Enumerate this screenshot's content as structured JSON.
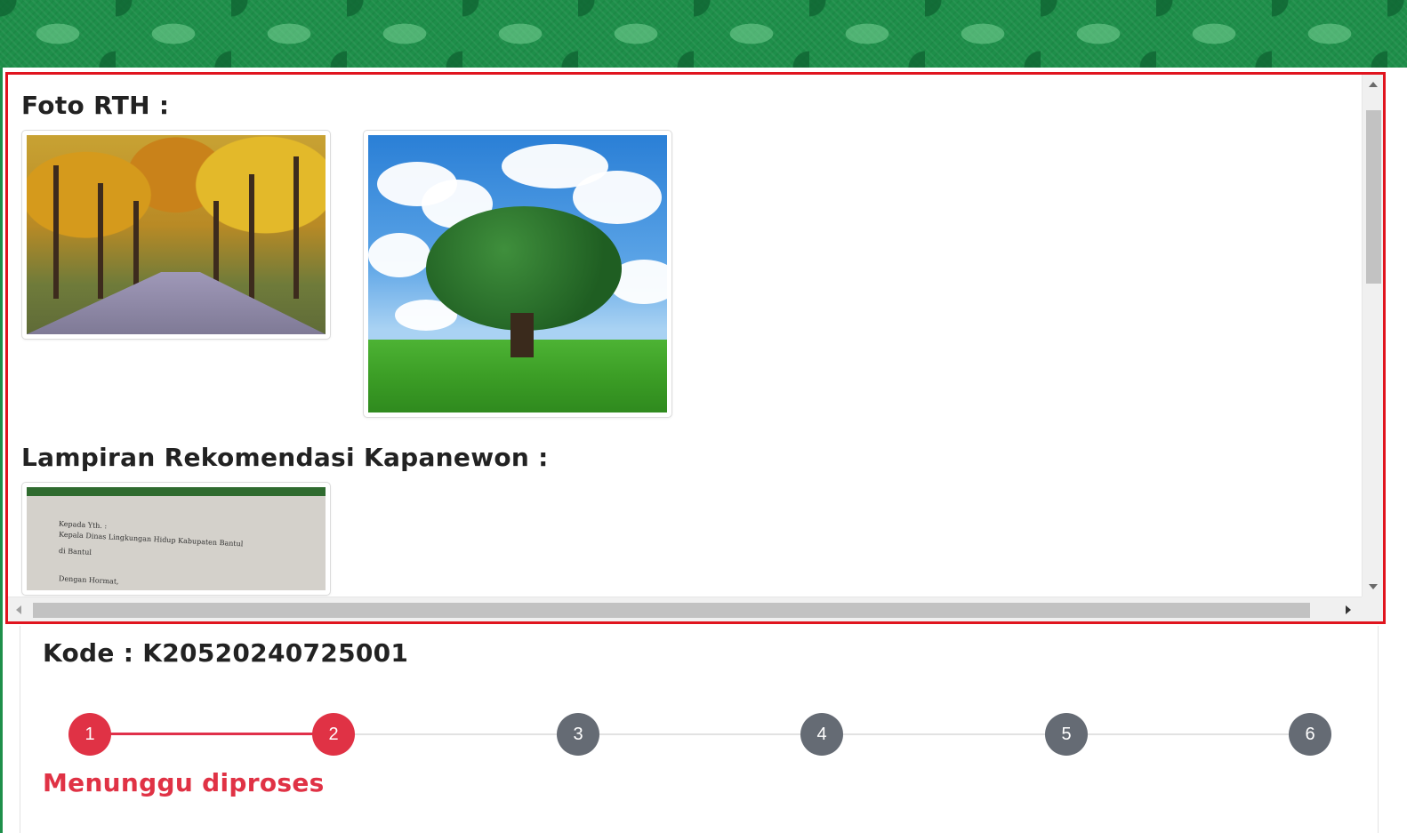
{
  "panel": {
    "foto_title": "Foto RTH :",
    "lampiran_title": "Lampiran Rekomendasi Kapanewon :",
    "document_lines": [
      "Kepada Yth. :",
      "Kepala Dinas Lingkungan Hidup Kabupaten Bantul",
      "di Bantul",
      "Dengan Hormat,"
    ]
  },
  "card": {
    "kode_text": "Kode : K20520240725001",
    "steps": [
      "1",
      "2",
      "3",
      "4",
      "5",
      "6"
    ],
    "active_step": 2,
    "status_text": "Menunggu diproses"
  },
  "colors": {
    "banner_green": "#1e8f4a",
    "panel_border_red": "#e0141e",
    "step_done": "#e03245",
    "step_todo": "#656b74",
    "status_red": "#e03245"
  }
}
